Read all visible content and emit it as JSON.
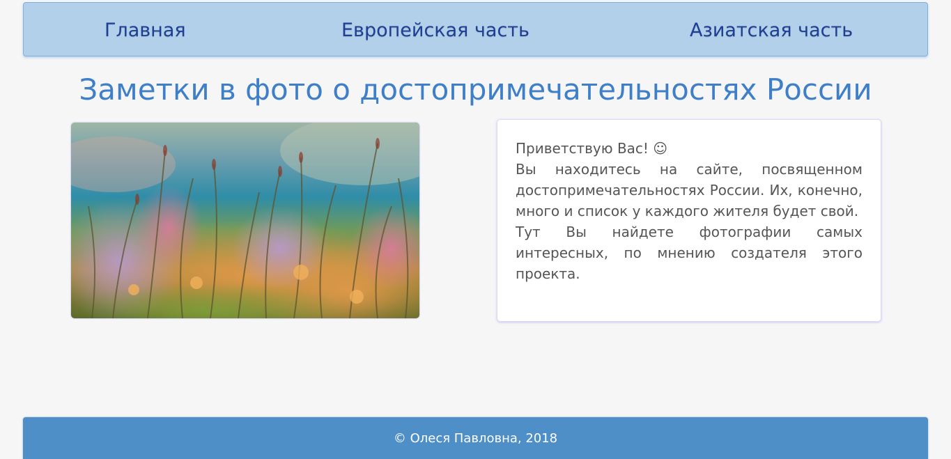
{
  "nav": {
    "items": [
      {
        "label": "Главная"
      },
      {
        "label": "Европейская часть"
      },
      {
        "label": "Азиатская часть"
      }
    ]
  },
  "main": {
    "title": "Заметки в фото о достопримечательностях России",
    "intro": {
      "greeting": "Приветствую Вас! ☺",
      "paragraph_1": "Вы находитесь на сайте, посвященном достопримечательностях России. Их, конечно, много и список у каждого жителя будет свой.",
      "paragraph_2": "Тут Вы найдете фотографии самых интересных, по мнению создателя этого проекта."
    },
    "photo_icon": "meadow-photo"
  },
  "footer": {
    "copyright": "© Олеся Павловна, 2018"
  },
  "colors": {
    "nav_background": "#b3d0eb",
    "nav_text": "#1f3f94",
    "title": "#3f7fc8",
    "footer_background": "#4e8fc7",
    "page_background": "#f6f6f7"
  }
}
